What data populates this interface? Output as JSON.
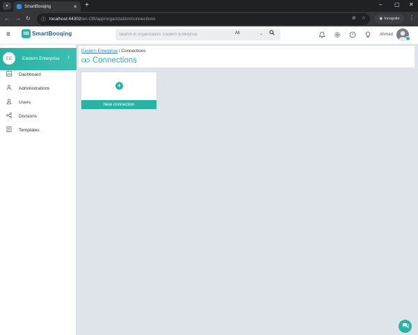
{
  "browser": {
    "tab_title": "SmartBooqing",
    "url_host": "localhost:44302",
    "url_path": "/en-GB/app/organization/connections",
    "incognito_label": "Incognito"
  },
  "app": {
    "logo_mark": "SB",
    "logo_text": "SmartBooqing",
    "search": {
      "placeholder": "Search in organization: Eastern Enterprise",
      "scope_value": "All"
    },
    "user_name": "Ahmed"
  },
  "sidebar": {
    "org_initials": "EE",
    "org_name": "Eastern Enterprise",
    "items": [
      {
        "label": "Dashboard",
        "icon": "dashboard-icon"
      },
      {
        "label": "Administrations",
        "icon": "administrations-icon"
      },
      {
        "label": "Users",
        "icon": "users-icon"
      },
      {
        "label": "Divisions",
        "icon": "divisions-icon"
      },
      {
        "label": "Templates",
        "icon": "templates-icon"
      }
    ]
  },
  "main": {
    "breadcrumb_parent": "Eastern Enterprise",
    "breadcrumb_separator": "/",
    "breadcrumb_current": "Connections",
    "title": "Connections",
    "new_connection_label": "New connection"
  },
  "colors": {
    "accent": "#2ab3a4",
    "brand_blue": "#1d5c96",
    "link": "#2a7fd4",
    "page_bg": "#dfe3ea"
  }
}
